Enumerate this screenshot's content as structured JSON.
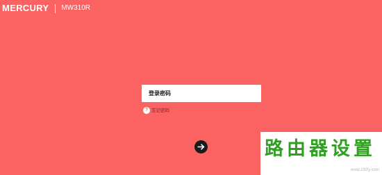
{
  "header": {
    "brand": "MERCURY",
    "model": "MW310R"
  },
  "login": {
    "password_placeholder": "登录密码",
    "forgot_label": "忘记密码",
    "help_icon": "question-icon",
    "submit_icon": "arrow-right-icon"
  },
  "watermark": {
    "title": "路由器设置",
    "url": "www.192ly.com"
  },
  "colors": {
    "background": "#fb6363",
    "input_background": "#ffffff",
    "submit_button": "#1a1a1a",
    "watermark_text": "#2fa01f"
  }
}
